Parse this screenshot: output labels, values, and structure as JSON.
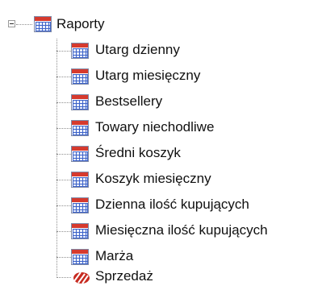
{
  "tree": {
    "root": {
      "label": "Raporty",
      "icon": "report-calendar-icon",
      "expanded": true
    },
    "children": [
      {
        "label": "Utarg dzienny",
        "icon": "report-calendar-icon"
      },
      {
        "label": "Utarg miesięczny",
        "icon": "report-calendar-icon"
      },
      {
        "label": "Bestsellery",
        "icon": "report-calendar-icon"
      },
      {
        "label": "Towary niechodliwe",
        "icon": "report-calendar-icon"
      },
      {
        "label": "Średni koszyk",
        "icon": "report-calendar-icon"
      },
      {
        "label": "Koszyk miesięczny",
        "icon": "report-calendar-icon"
      },
      {
        "label": "Dzienna ilość kupujących",
        "icon": "report-calendar-icon"
      },
      {
        "label": "Miesięczna ilość kupujących",
        "icon": "report-calendar-icon"
      },
      {
        "label": "Marża",
        "icon": "report-calendar-icon"
      },
      {
        "label": "Sprzedaż",
        "icon": "sales-icon"
      }
    ]
  },
  "colors": {
    "icon_header": "#d63a2e",
    "icon_grid": "#3d63c9",
    "tree_lines": "#8f8f8f",
    "text": "#101010"
  }
}
